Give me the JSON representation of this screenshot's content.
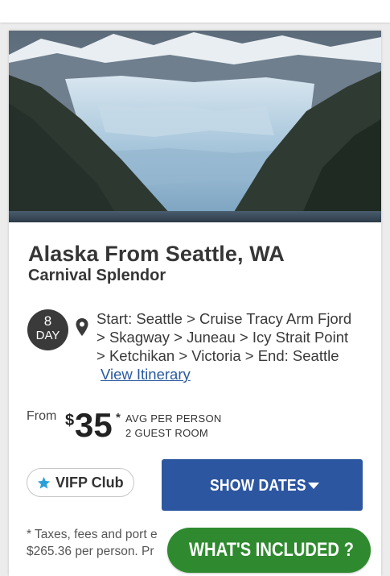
{
  "hero": {
    "image_name": "alaska-glacier-photo"
  },
  "cruise": {
    "title": "Alaska From Seattle, WA",
    "ship": "Carnival Splendor"
  },
  "duration": {
    "number": "8",
    "unit": "DAY"
  },
  "itinerary": {
    "lines": [
      "Start: Seattle > Cruise Tracy Arm Fjord",
      "> Skagway > Juneau > Icy Strait Point",
      "> Ketchikan > Victoria > End: Seattle"
    ],
    "link_label": "View Itinerary"
  },
  "pricing": {
    "from_label": "From",
    "currency": "$",
    "amount": "35",
    "asterisk": "*",
    "avg_line1": "AVG PER PERSON",
    "avg_line2": "2 GUEST ROOM"
  },
  "vifp": {
    "label": "VIFP Club",
    "icon": "star-icon"
  },
  "buttons": {
    "show_dates": "SHOW DATES",
    "whats_included": "WHAT'S INCLUDED ?"
  },
  "disclaimer": {
    "line1": "* Taxes, fees and port e",
    "line2": "$265.36 per person. Pr"
  },
  "colors": {
    "primary_blue": "#2d56a0",
    "action_green": "#2f8a2f",
    "link_blue": "#2a5aa0",
    "badge_dark": "#3a3a3a",
    "star_teal": "#2b9fd8"
  }
}
